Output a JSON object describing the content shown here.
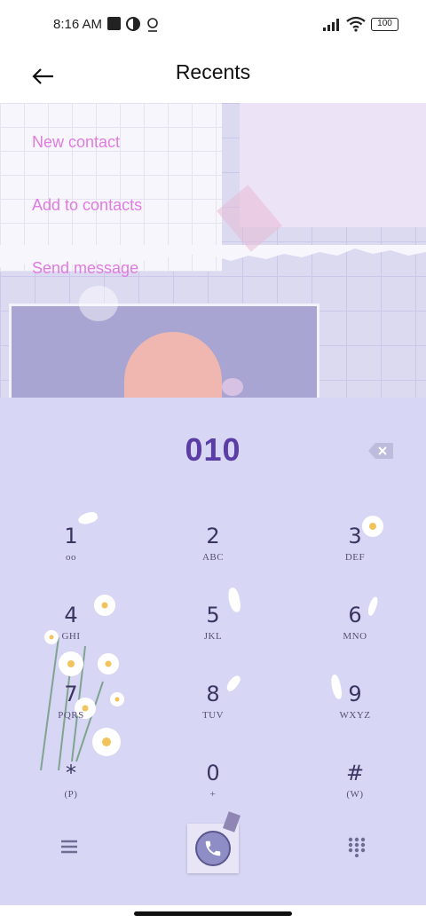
{
  "status_bar": {
    "time": "8:16 AM",
    "battery": "100"
  },
  "app_bar": {
    "title": "Recents",
    "back_icon": "arrow-left-icon"
  },
  "actions": [
    {
      "label": "New contact"
    },
    {
      "label": "Add to contacts"
    },
    {
      "label": "Send message"
    }
  ],
  "dialer": {
    "number": "010",
    "keys": [
      {
        "digit": "1",
        "letters": "oo"
      },
      {
        "digit": "2",
        "letters": "ABC"
      },
      {
        "digit": "3",
        "letters": "DEF"
      },
      {
        "digit": "4",
        "letters": "GHI"
      },
      {
        "digit": "5",
        "letters": "JKL"
      },
      {
        "digit": "6",
        "letters": "MNO"
      },
      {
        "digit": "7",
        "letters": "PQRS"
      },
      {
        "digit": "8",
        "letters": "TUV"
      },
      {
        "digit": "9",
        "letters": "WXYZ"
      },
      {
        "digit": "*",
        "letters": "(P)"
      },
      {
        "digit": "0",
        "letters": "+"
      },
      {
        "digit": "#",
        "letters": "(W)"
      }
    ]
  },
  "colors": {
    "action_text": "#e07be0",
    "number_text": "#5a3ea6",
    "dialer_bg": "#d7d6f4"
  }
}
